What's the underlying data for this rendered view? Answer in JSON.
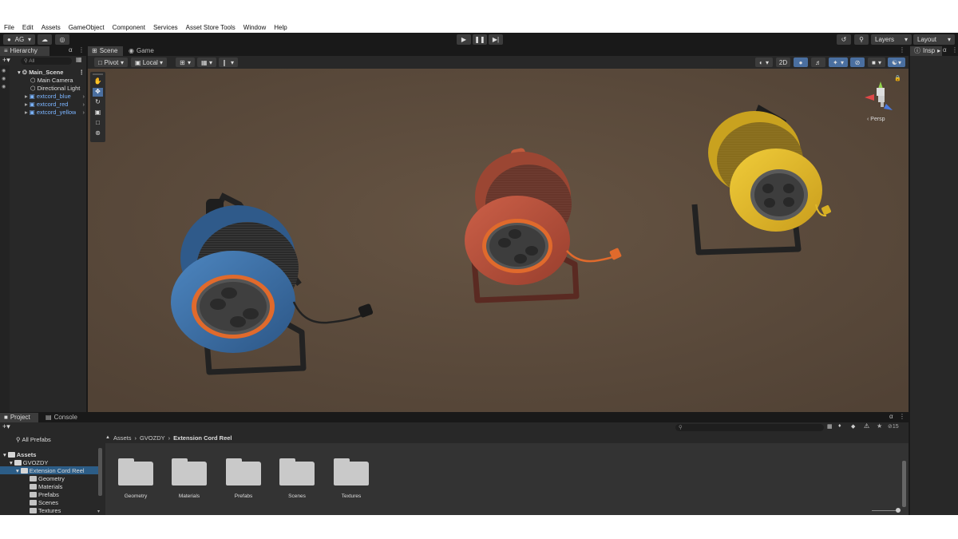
{
  "menu": [
    "File",
    "Edit",
    "Assets",
    "GameObject",
    "Component",
    "Services",
    "Asset Store Tools",
    "Window",
    "Help"
  ],
  "toolbar": {
    "account": "AG",
    "layers": "Layers",
    "layout": "Layout"
  },
  "hierarchy": {
    "tab": "Hierarchy",
    "search_placeholder": "All",
    "items": [
      {
        "label": "Main_Scene"
      },
      {
        "label": "Main Camera"
      },
      {
        "label": "Directional Light"
      },
      {
        "label": "extcord_blue"
      },
      {
        "label": "extcord_red"
      },
      {
        "label": "extcord_yellow"
      }
    ]
  },
  "scene": {
    "tabs": [
      "Scene",
      "Game"
    ],
    "pivot": "Pivot",
    "local": "Local",
    "mode_2d": "2D",
    "persp": "‹ Persp"
  },
  "inspector": {
    "tab": "Insp"
  },
  "project": {
    "tabs": [
      "Project",
      "Console"
    ],
    "all_prefabs": "All Prefabs",
    "tree": [
      "Assets",
      "GVOZDY",
      "Extension Cord Reel",
      "Geometry",
      "Materials",
      "Prefabs",
      "Scenes",
      "Textures"
    ],
    "breadcrumb": [
      "Assets",
      "GVOZDY",
      "Extension Cord Reel"
    ],
    "folders": [
      "Geometry",
      "Materials",
      "Prefabs",
      "Scenes",
      "Textures"
    ],
    "hidden_count": "15"
  },
  "colors": {
    "reel_blue": "#3a6fa8",
    "reel_red": "#b8503a",
    "reel_yellow": "#e0b92a",
    "orange_ring": "#e06a2c",
    "floor": "#5e4d3d"
  }
}
